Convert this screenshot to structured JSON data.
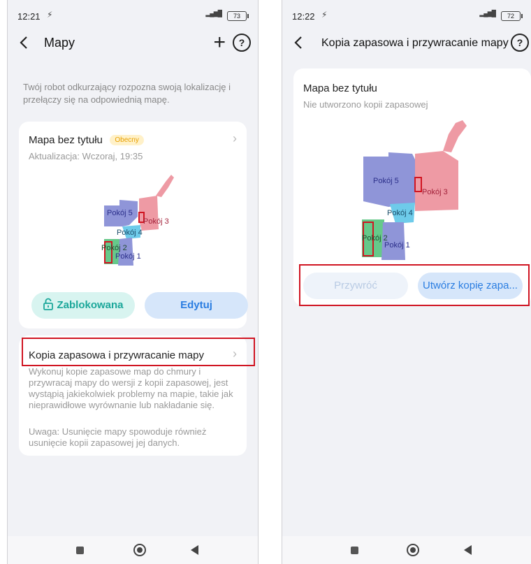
{
  "colors": {
    "accent": "#2a7de1",
    "locked_green": "#1ba79a",
    "highlight_red": "#d01522",
    "badge_bg": "#fff1c9",
    "badge_text": "#e8a000",
    "room_blue": "#8f95d8",
    "room_red": "#ee9aa4",
    "room_green": "#66c98a",
    "room_cyan": "#6ecbea"
  },
  "left": {
    "status": {
      "time": "12:21",
      "battery": "73"
    },
    "header": {
      "title": "Mapy"
    },
    "description": "Twój robot odkurzający rozpozna swoją lokalizację i przełączy się na odpowiednią mapę.",
    "map_card": {
      "title": "Mapa bez tytułu",
      "badge": "Obecny",
      "updated": "Aktualizacja: Wczoraj, 19:35",
      "rooms": [
        "Pokój 5",
        "Pokój 3",
        "Pokój 4",
        "Pokój 2",
        "Pokój 1"
      ],
      "locked_label": "Zablokowana",
      "edit_label": "Edytuj"
    },
    "backup_card": {
      "title": "Kopia zapasowa i przywracanie mapy",
      "body": "Wykonuj kopie zapasowe map do chmury i przywracaj mapy do wersji z kopii zapasowej, jest wystąpią jakiekolwiek problemy na mapie, takie jak nieprawidłowe wyrównanie lub nakładanie się.",
      "note": "Uwaga: Usunięcie mapy spowoduje również usunięcie kopii zapasowej jej danych."
    }
  },
  "right": {
    "status": {
      "time": "12:22",
      "battery": "72"
    },
    "header": {
      "title": "Kopia zapasowa i przywracanie mapy"
    },
    "map_card": {
      "title": "Mapa bez tytułu",
      "subtitle": "Nie utworzono kopii zapasowej",
      "rooms": [
        "Pokój 5",
        "Pokój 3",
        "Pokój 4",
        "Pokój 2",
        "Pokój 1"
      ],
      "restore_label": "Przywróć",
      "create_backup_label": "Utwórz kopię zapa..."
    }
  },
  "icons": {
    "status_signal": "LTE signal",
    "battery": "battery-icon",
    "back": "chevron-left-icon",
    "add": "plus-icon",
    "help": "question-icon",
    "lock": "lock-icon",
    "chevron": "chevron-right-icon"
  }
}
